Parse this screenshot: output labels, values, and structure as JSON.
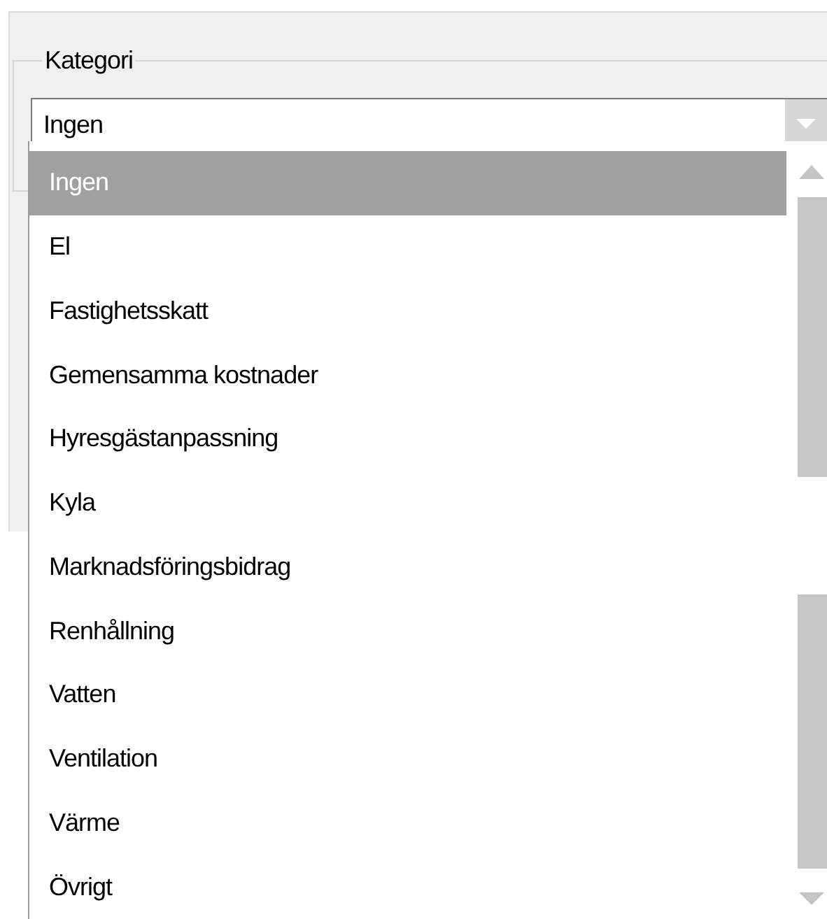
{
  "group": {
    "title": "Kategori"
  },
  "combo": {
    "value": "Ingen",
    "expanded": true
  },
  "options": [
    {
      "label": "Ingen",
      "selected": true
    },
    {
      "label": "El",
      "selected": false
    },
    {
      "label": "Fastighetsskatt",
      "selected": false
    },
    {
      "label": "Gemensamma kostnader",
      "selected": false
    },
    {
      "label": "Hyresgästanpassning",
      "selected": false
    },
    {
      "label": "Kyla",
      "selected": false
    },
    {
      "label": "Marknadsföringsbidrag",
      "selected": false
    },
    {
      "label": "Renhållning",
      "selected": false
    },
    {
      "label": "Vatten",
      "selected": false
    },
    {
      "label": "Ventilation",
      "selected": false
    },
    {
      "label": "Värme",
      "selected": false
    },
    {
      "label": "Övrigt",
      "selected": false
    }
  ]
}
